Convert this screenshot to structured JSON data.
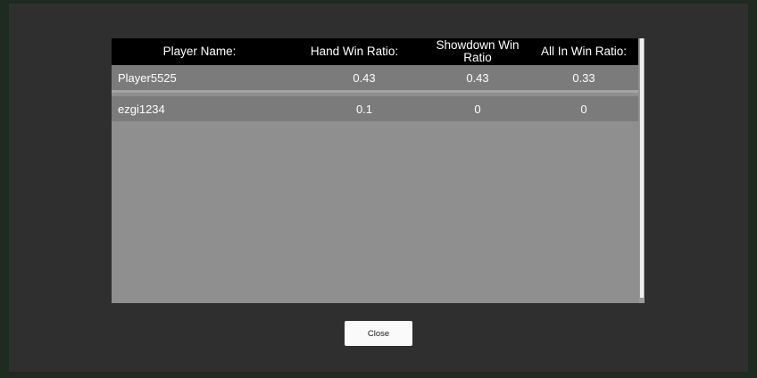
{
  "table": {
    "headers": {
      "player_name": "Player Name:",
      "hand_win_ratio": "Hand Win Ratio:",
      "showdown_win_ratio": "Showdown Win Ratio",
      "all_in_win_ratio": "All In Win Ratio:"
    },
    "rows": [
      {
        "player_name": "Player5525",
        "hand_win_ratio": "0.43",
        "showdown_win_ratio": "0.43",
        "all_in_win_ratio": "0.33"
      },
      {
        "player_name": "ezgi1234",
        "hand_win_ratio": "0.1",
        "showdown_win_ratio": "0",
        "all_in_win_ratio": "0"
      }
    ]
  },
  "close_label": "Close",
  "colors": {
    "background": "#1f2a21",
    "modal": "#2f2f30",
    "table_panel": "#8f8f8f",
    "header": "#000000",
    "row": "#7b7b7b"
  }
}
